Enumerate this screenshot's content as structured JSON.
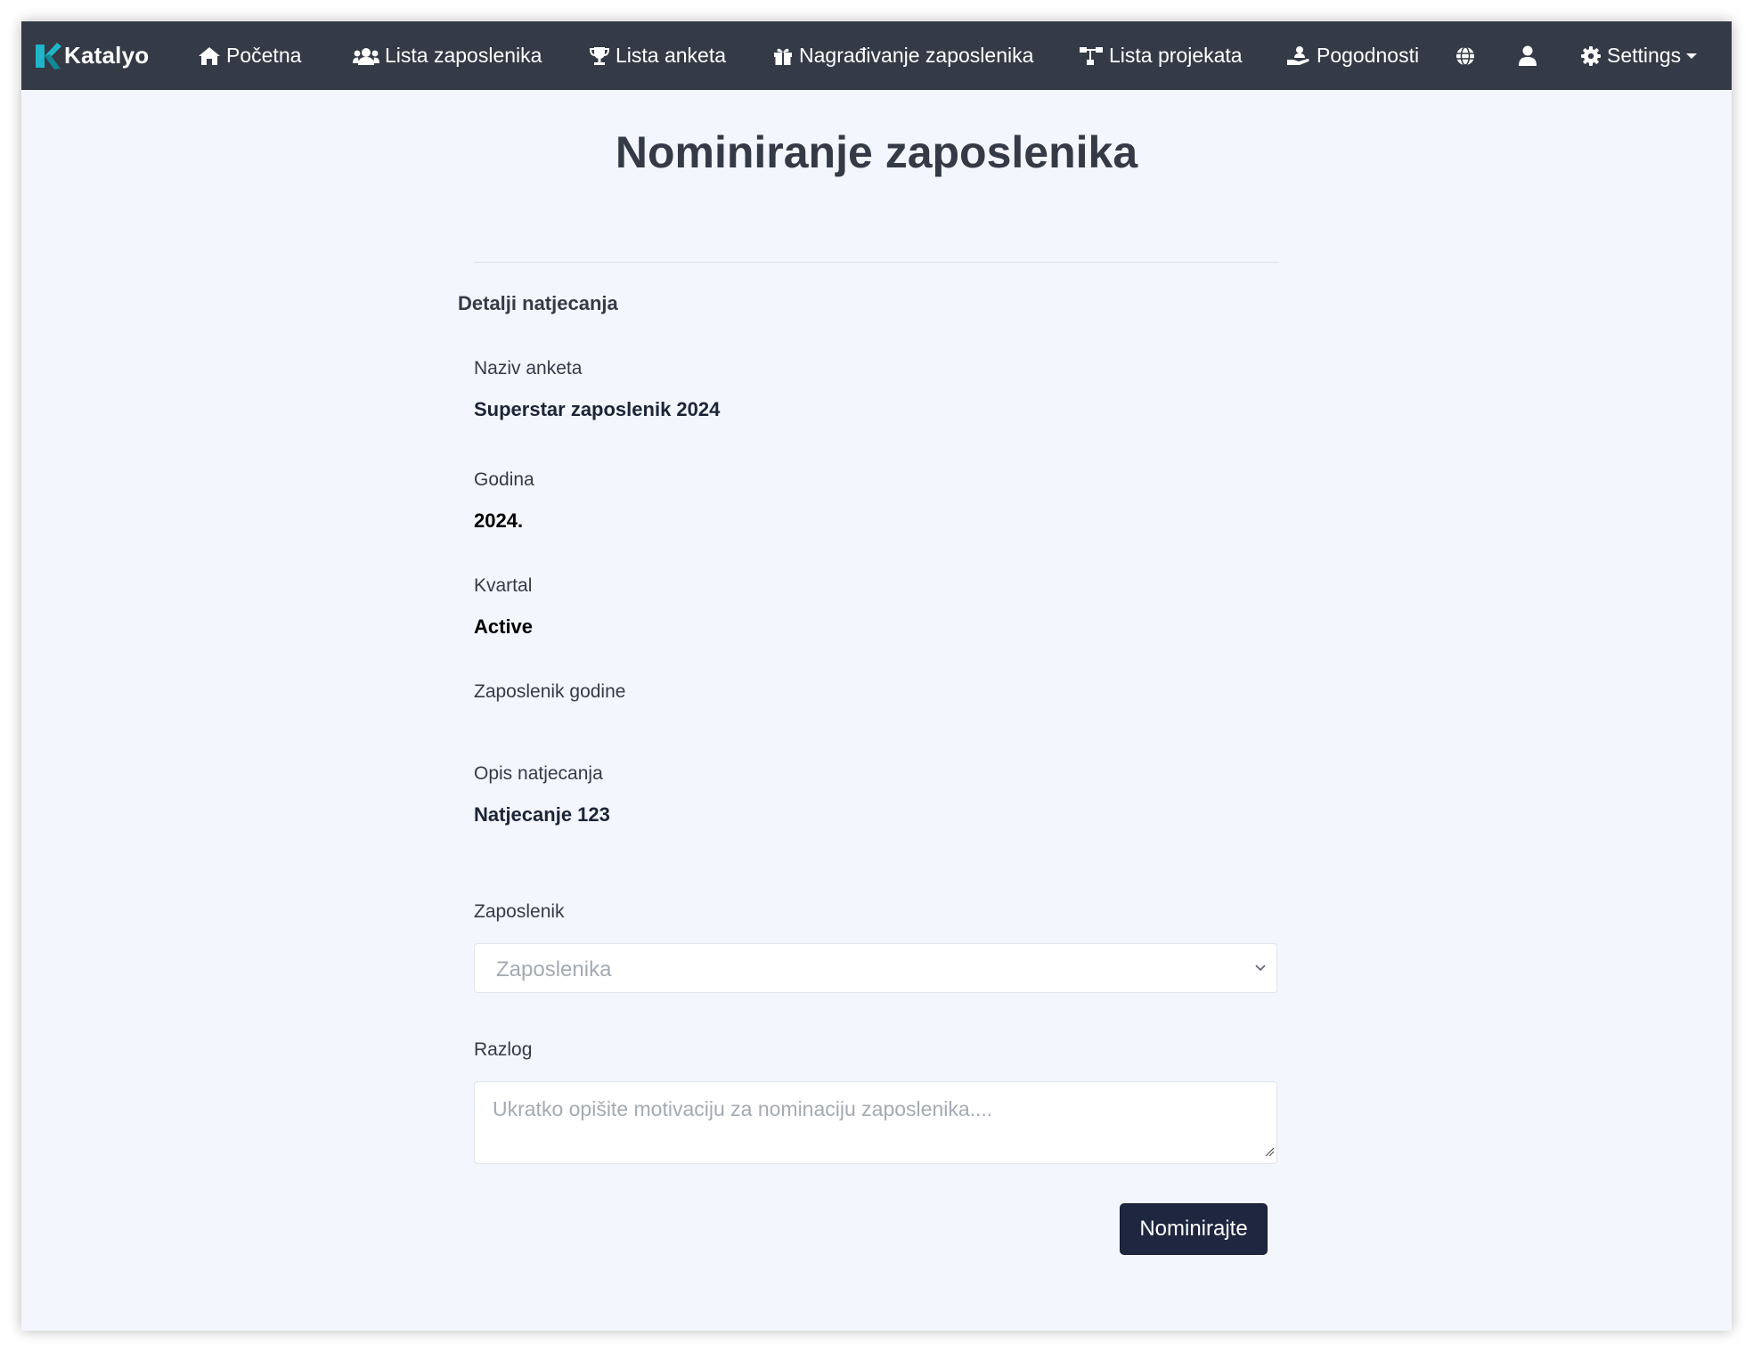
{
  "navbar": {
    "brand": "Katalyo",
    "items": [
      {
        "label": "Početna",
        "icon": "home-icon"
      },
      {
        "label": "Lista zaposlenika",
        "icon": "users-icon"
      },
      {
        "label": "Lista anketa",
        "icon": "trophy-icon"
      },
      {
        "label": "Nagrađivanje zaposlenika",
        "icon": "gift-icon"
      },
      {
        "label": "Lista projekata",
        "icon": "sitemap-icon"
      },
      {
        "label": "Pogodnosti",
        "icon": "hand-holding-user-icon"
      }
    ],
    "globe_icon": "globe-icon",
    "user_icon": "user-icon",
    "settings": {
      "label": "Settings",
      "icon": "gear-icon"
    }
  },
  "page": {
    "title": "Nominiranje zaposlenika"
  },
  "details": {
    "section_title": "Detalji natjecanja",
    "fields": [
      {
        "label": "Naziv anketa",
        "value": "Superstar zaposlenik 2024"
      },
      {
        "label": "Godina",
        "value": "2024."
      },
      {
        "label": "Kvartal",
        "value": "Active"
      },
      {
        "label": "Zaposlenik godine",
        "value": ""
      },
      {
        "label": "Opis natjecanja",
        "value": "Natjecanje 123"
      }
    ]
  },
  "form": {
    "employee_label": "Zaposlenik",
    "employee_placeholder": "Zaposlenika",
    "reason_label": "Razlog",
    "reason_placeholder": "Ukratko opišite motivaciju za nominaciju zaposlenika....",
    "submit_label": "Nominirajte"
  },
  "colors": {
    "navbar": "#343a46",
    "background": "#f3f6fc",
    "button": "#1f2740",
    "brand_accent": "#1fb6c8"
  }
}
